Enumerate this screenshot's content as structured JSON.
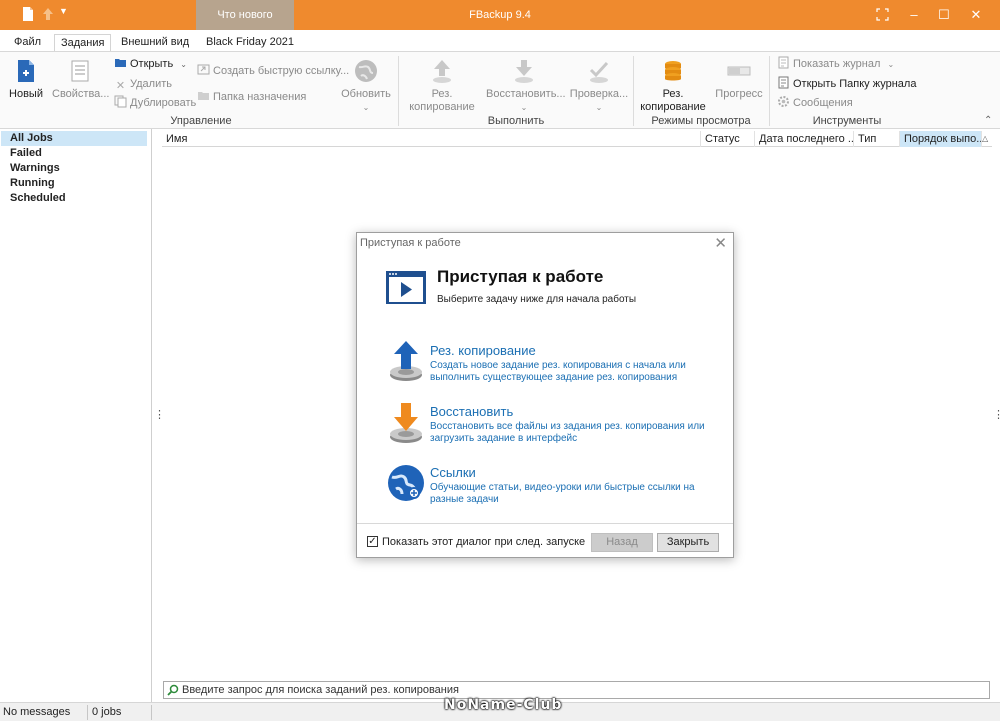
{
  "titlebar": {
    "whats_new_tab": "Что нового",
    "app_title": "FBackup 9.4",
    "minimize": "–",
    "maximize": "☐",
    "close": "✕"
  },
  "menu": {
    "file": "Файл",
    "tasks": "Задания",
    "view": "Внешний вид",
    "black_friday": "Black Friday 2021"
  },
  "ribbon": {
    "new": "Новый",
    "properties": "Свойства...",
    "open": "Открыть",
    "delete": "Удалить",
    "duplicate": "Дублировать",
    "create_shortcut": "Создать быструю ссылку...",
    "destination_folder": "Папка назначения",
    "update": "Обновить",
    "group_manage": "Управление",
    "backup_line1": "Рез.",
    "backup_line2": "копирование",
    "restore": "Восстановить...",
    "check": "Проверка...",
    "group_execute": "Выполнить",
    "mode_backup_line1": "Рез.",
    "mode_backup_line2": "копирование",
    "progress": "Прогресс",
    "group_view_modes": "Режимы просмотра",
    "show_log": "Показать журнал",
    "open_log_folder": "Открыть Папку журнала",
    "messages": "Сообщения",
    "group_tools": "Инструменты"
  },
  "sidebar": {
    "items": [
      {
        "label": "All Jobs"
      },
      {
        "label": "Failed"
      },
      {
        "label": "Warnings"
      },
      {
        "label": "Running"
      },
      {
        "label": "Scheduled"
      }
    ]
  },
  "table": {
    "columns": [
      "Имя",
      "Статус",
      "Дата последнего ...",
      "Тип",
      "Порядок выпо..."
    ]
  },
  "search": {
    "placeholder": "Введите запрос для поиска заданий рез. копирования"
  },
  "statusbar": {
    "messages": "No messages",
    "jobs": "0 jobs"
  },
  "watermark": "NoName-Club",
  "dialog": {
    "window_title": "Приступая к работе",
    "heading": "Приступая к работе",
    "subheading": "Выберите задачу ниже для начала работы",
    "options": [
      {
        "title": "Рез. копирование",
        "line1": "Создать новое задание рез. копирования с начала или",
        "line2": "выполнить существующее задание рез. копирования"
      },
      {
        "title": "Восстановить",
        "line1": "Восстановить все файлы из задания рез. копирования или",
        "line2": "загрузить задание в интерфейс"
      },
      {
        "title": "Ссылки",
        "line1": "Обучающие статьи, видео-уроки или быстрые ссылки на",
        "line2": "разные задачи"
      }
    ],
    "show_on_startup": "Показать этот диалог при след. запуске",
    "back": "Назад",
    "close": "Закрыть"
  },
  "colors": {
    "accent": "#ef8a2e",
    "link": "#1b6fb3",
    "selection": "#cde6f7"
  }
}
